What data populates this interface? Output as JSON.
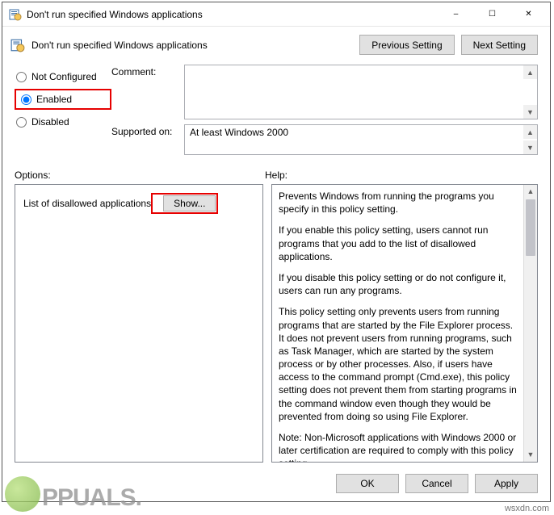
{
  "window": {
    "title": "Don't run specified Windows applications"
  },
  "header": {
    "title": "Don't run specified Windows applications",
    "prev_label": "Previous Setting",
    "next_label": "Next Setting"
  },
  "state": {
    "not_configured_label": "Not Configured",
    "enabled_label": "Enabled",
    "disabled_label": "Disabled",
    "selected": "enabled"
  },
  "form": {
    "comment_label": "Comment:",
    "comment_value": "",
    "supported_label": "Supported on:",
    "supported_value": "At least Windows 2000"
  },
  "sections": {
    "options_label": "Options:",
    "help_label": "Help:"
  },
  "options": {
    "list_label": "List of disallowed applications",
    "show_label": "Show..."
  },
  "help": {
    "p1": "Prevents Windows from running the programs you specify in this policy setting.",
    "p2": "If you enable this policy setting, users cannot run programs that you add to the list of disallowed applications.",
    "p3": "If you disable this policy setting or do not configure it, users can run any programs.",
    "p4": "This policy setting only prevents users from running programs that are started by the File Explorer process. It does not prevent users from running programs, such as Task Manager, which are started by the system process or by other processes.  Also, if users have access to the command prompt (Cmd.exe), this policy setting does not prevent them from starting programs in the command window even though they would be prevented from doing so using File Explorer.",
    "p5": "Note: Non-Microsoft applications with Windows 2000 or later certification are required to comply with this policy setting.\nNote: To create a list of allowed applications, click Show.  In the"
  },
  "footer": {
    "ok_label": "OK",
    "cancel_label": "Cancel",
    "apply_label": "Apply"
  },
  "watermark": {
    "brand": "PPUALS.",
    "url": "wsxdn.com"
  }
}
